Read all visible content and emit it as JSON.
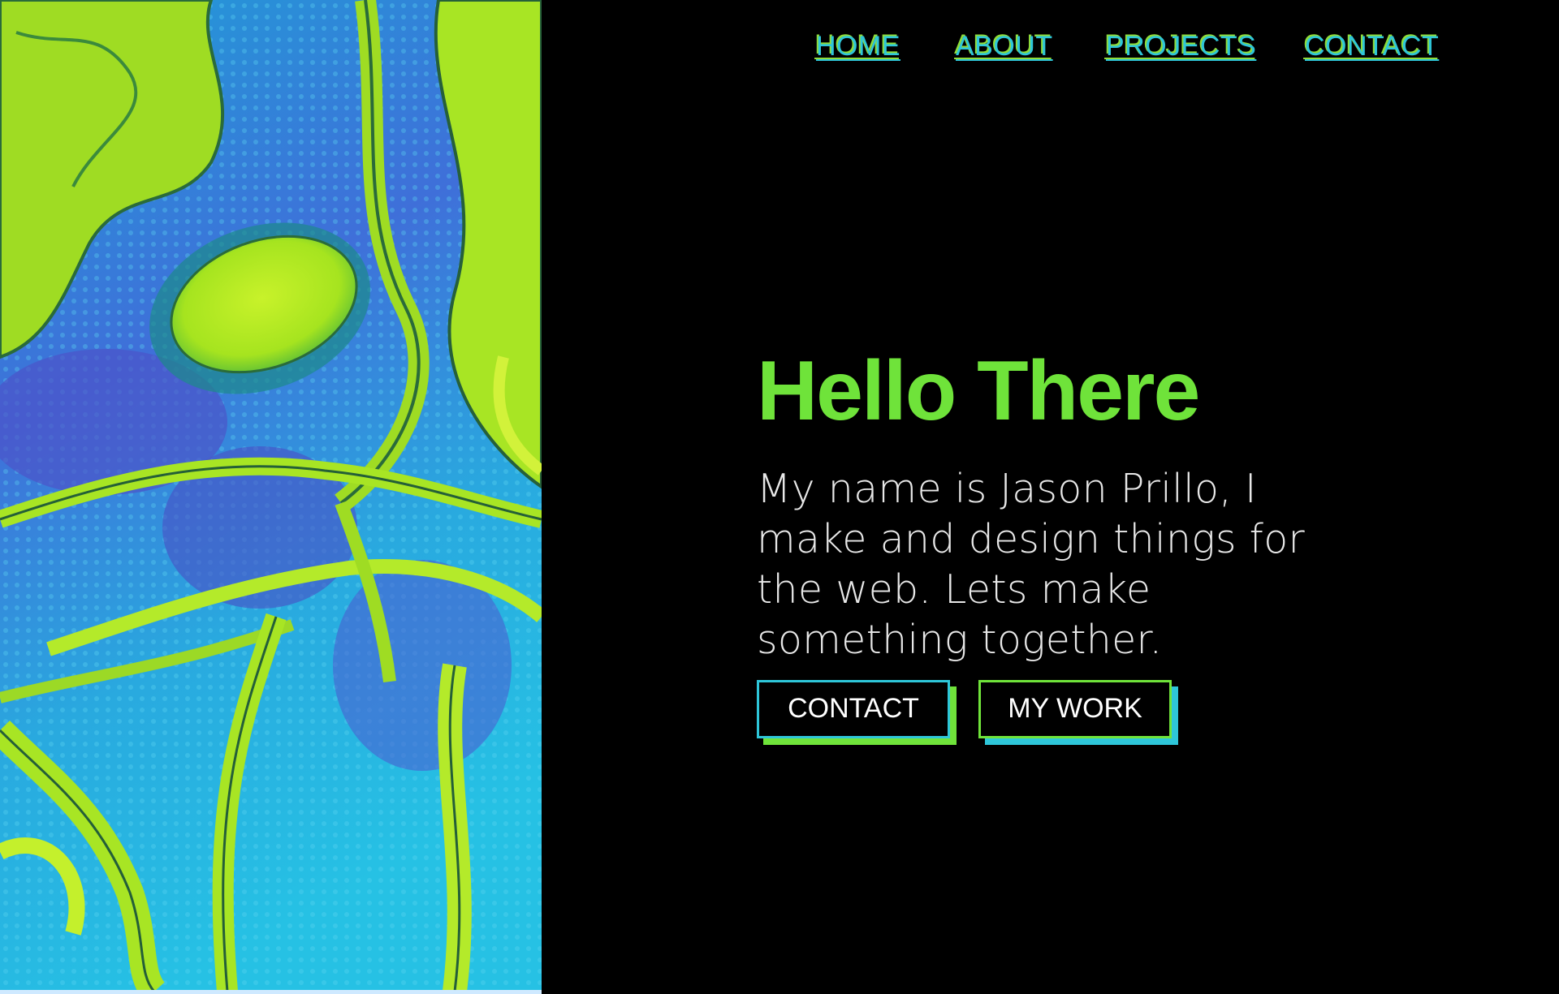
{
  "nav": {
    "items": [
      {
        "label": "HOME"
      },
      {
        "label": "ABOUT"
      },
      {
        "label": "PROJECTS"
      },
      {
        "label": "CONTACT"
      }
    ]
  },
  "hero": {
    "title": "Hello There",
    "text": "My name is Jason Prillo, I make and design things for the web. Lets make something together."
  },
  "buttons": {
    "contact_label": "CONTACT",
    "work_label": "MY WORK"
  },
  "colors": {
    "accent_green": "#6fe33a",
    "accent_cyan": "#2ec6d9",
    "background": "#000000",
    "body_text": "#e8e8e8"
  },
  "art": {
    "icon": "abstract-paint-artwork"
  }
}
